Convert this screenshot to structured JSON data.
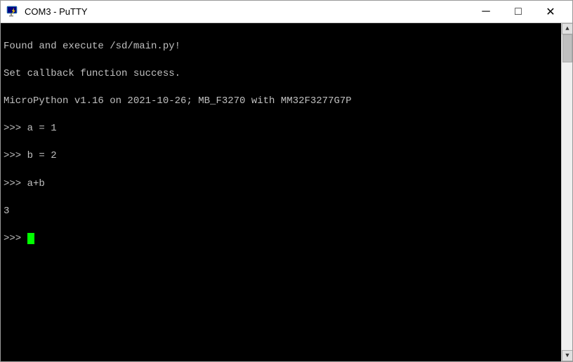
{
  "window": {
    "title": "COM3 - PuTTY",
    "icon": "🖥"
  },
  "titlebar": {
    "minimize_label": "─",
    "maximize_label": "□",
    "close_label": "✕"
  },
  "terminal": {
    "lines": [
      {
        "text": "Found and execute /sd/main.py!",
        "color": "#c0c0c0"
      },
      {
        "text": "Set callback function success.",
        "color": "#c0c0c0"
      },
      {
        "text": "MicroPython v1.16 on 2021-10-26; MB_F3270 with MM32F3277G7P",
        "color": "#c0c0c0"
      },
      {
        "text": ">>> a = 1",
        "color": "#c0c0c0"
      },
      {
        "text": ">>> b = 2",
        "color": "#c0c0c0"
      },
      {
        "text": ">>> a+b",
        "color": "#c0c0c0"
      },
      {
        "text": "3",
        "color": "#c0c0c0"
      },
      {
        "text": ">>> ",
        "color": "#c0c0c0",
        "has_cursor": true
      }
    ]
  }
}
